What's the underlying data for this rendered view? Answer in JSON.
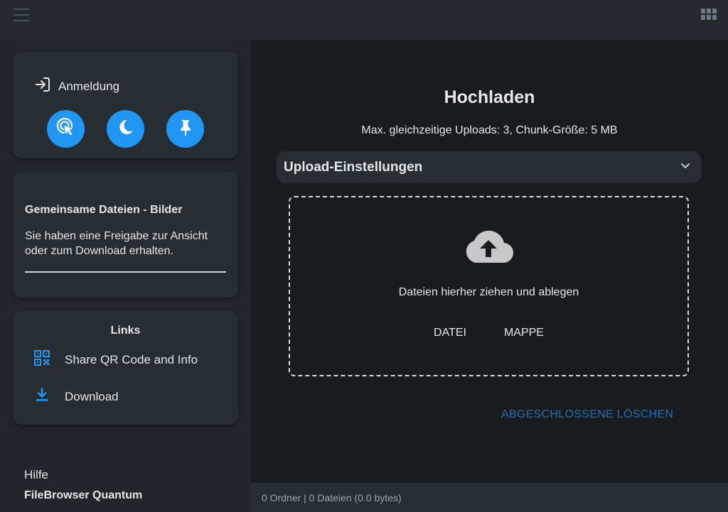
{
  "topbar": {
    "menu_icon": "hamburger-menu-icon",
    "view_icon": "grid-view-icon"
  },
  "sidebar": {
    "login": {
      "icon": "login-icon",
      "label": "Anmeldung"
    },
    "round_buttons": [
      {
        "name": "touch-cursor-icon"
      },
      {
        "name": "dark-mode-icon"
      },
      {
        "name": "pin-icon"
      }
    ],
    "share": {
      "title": "Gemeinsame Dateien - Bilder",
      "description": "Sie haben eine Freigabe zur Ansicht oder zum Download erhalten."
    },
    "links": {
      "title": "Links",
      "items": [
        {
          "label": "Share QR Code and Info",
          "icon": "qr-code-icon"
        },
        {
          "label": "Download",
          "icon": "download-icon"
        }
      ]
    },
    "help": "Hilfe",
    "brand": "FileBrowser Quantum"
  },
  "main": {
    "title": "Hochladen",
    "subtitle": "Max. gleichzeitige Uploads: 3, Chunk-Größe: 5 MB",
    "settings_label": "Upload-Einstellungen",
    "dropzone": {
      "icon": "cloud-upload-icon",
      "text": "Dateien hierher ziehen und ablegen",
      "file_button": "DATEI",
      "folder_button": "MAPPE"
    },
    "clear_button": "ABGESCHLOSSENE LÖSCHEN"
  },
  "status": {
    "text": "0 Ordner | 0 Dateien (0.0 bytes)"
  },
  "colors": {
    "accent": "#2196f3",
    "link_blue": "#1f6fb3",
    "main_bg": "#181c21",
    "card_bg": "#262d33"
  }
}
